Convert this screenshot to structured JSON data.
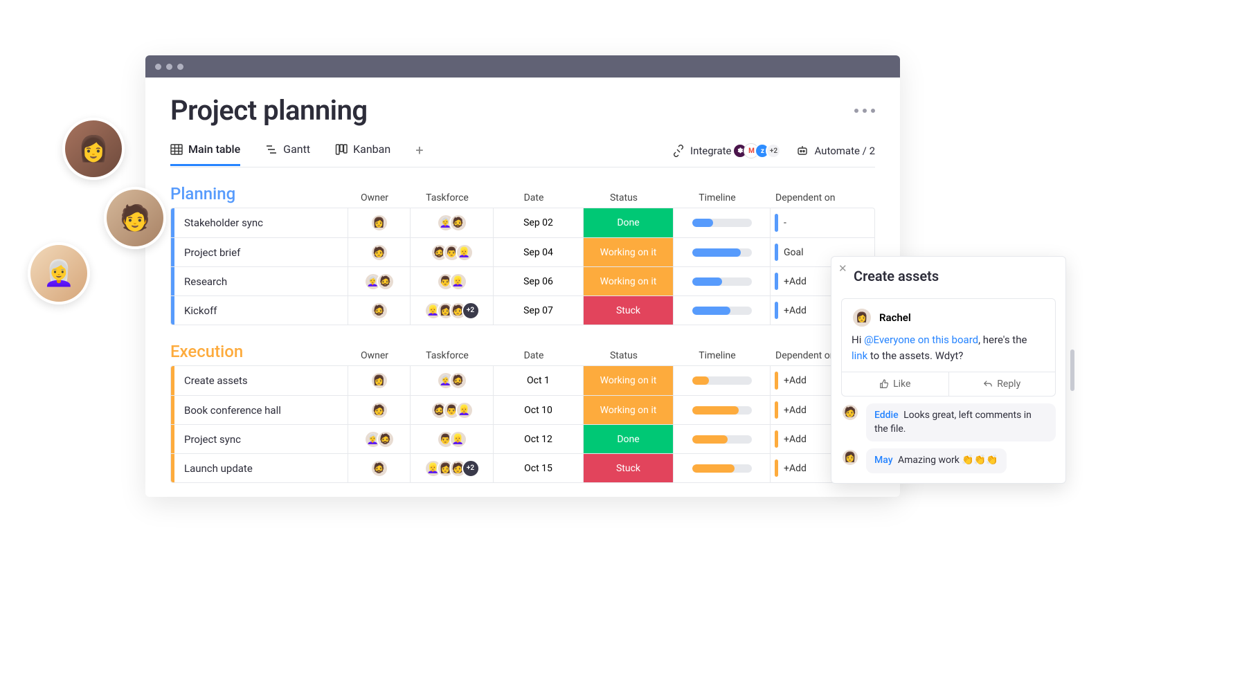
{
  "board_title": "Project planning",
  "tabs": {
    "main": "Main table",
    "gantt": "Gantt",
    "kanban": "Kanban"
  },
  "integrate_label": "Integrate",
  "integrate_more": "+2",
  "automate_label": "Automate / 2",
  "columns": {
    "owner": "Owner",
    "taskforce": "Taskforce",
    "date": "Date",
    "status": "Status",
    "timeline": "Timeline",
    "dependent": "Dependent on"
  },
  "groups": [
    {
      "title": "Planning",
      "color": "#579bfc",
      "rows": [
        {
          "name": "Stakeholder sync",
          "owner_count": 1,
          "taskforce_count": 2,
          "taskforce_more": 0,
          "date": "Sep 02",
          "status": "Done",
          "status_class": "st-done",
          "tl_fill": 35,
          "tl_color": "tl-blue",
          "dep": "-"
        },
        {
          "name": "Project brief",
          "owner_count": 1,
          "taskforce_count": 3,
          "taskforce_more": 0,
          "date": "Sep 04",
          "status": "Working on it",
          "status_class": "st-working",
          "tl_fill": 82,
          "tl_color": "tl-blue",
          "dep": "Goal"
        },
        {
          "name": "Research",
          "owner_count": 2,
          "taskforce_count": 2,
          "taskforce_more": 0,
          "date": "Sep 06",
          "status": "Working on it",
          "status_class": "st-working",
          "tl_fill": 50,
          "tl_color": "tl-blue",
          "dep": "+Add"
        },
        {
          "name": "Kickoff",
          "owner_count": 1,
          "taskforce_count": 3,
          "taskforce_more": 2,
          "date": "Sep 07",
          "status": "Stuck",
          "status_class": "st-stuck",
          "tl_fill": 65,
          "tl_color": "tl-blue",
          "dep": "+Add"
        }
      ]
    },
    {
      "title": "Execution",
      "color": "#fdab3d",
      "rows": [
        {
          "name": "Create assets",
          "owner_count": 1,
          "taskforce_count": 2,
          "taskforce_more": 0,
          "date": "Oct 1",
          "status": "Working on it",
          "status_class": "st-working",
          "tl_fill": 28,
          "tl_color": "tl-orange",
          "dep": "+Add"
        },
        {
          "name": "Book conference hall",
          "owner_count": 1,
          "taskforce_count": 3,
          "taskforce_more": 0,
          "date": "Oct 10",
          "status": "Working on it",
          "status_class": "st-working",
          "tl_fill": 78,
          "tl_color": "tl-orange",
          "dep": "+Add"
        },
        {
          "name": "Project sync",
          "owner_count": 2,
          "taskforce_count": 2,
          "taskforce_more": 0,
          "date": "Oct 12",
          "status": "Done",
          "status_class": "st-done",
          "tl_fill": 60,
          "tl_color": "tl-orange",
          "dep": "+Add"
        },
        {
          "name": "Launch update",
          "owner_count": 1,
          "taskforce_count": 3,
          "taskforce_more": 2,
          "date": "Oct 15",
          "status": "Stuck",
          "status_class": "st-stuck",
          "tl_fill": 72,
          "tl_color": "tl-orange",
          "dep": "+Add"
        }
      ]
    }
  ],
  "panel": {
    "title": "Create assets",
    "author": "Rachel",
    "body_pre": "Hi ",
    "mention": "@Everyone on this board",
    "body_mid": ", here's the ",
    "link": "link",
    "body_post": " to the assets. Wdyt?",
    "like": "Like",
    "reply": "Reply",
    "replies": [
      {
        "name": "Eddie",
        "text": "Looks great, left comments in the file."
      },
      {
        "name": "May",
        "text": "Amazing work 👏👏👏"
      }
    ]
  }
}
